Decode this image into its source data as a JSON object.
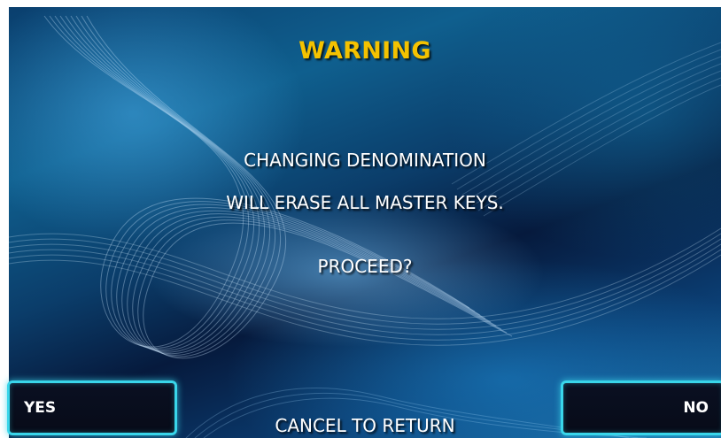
{
  "screen": {
    "title": "WARNING",
    "message_line1": "CHANGING DENOMINATION",
    "message_line2": "WILL ERASE ALL MASTER KEYS.",
    "prompt": "PROCEED?",
    "footer": "CANCEL TO RETURN"
  },
  "buttons": {
    "yes_label": "YES",
    "no_label": "NO"
  },
  "colors": {
    "title": "#f4c200",
    "button_border": "#39d6ea",
    "text": "#ffffff"
  }
}
